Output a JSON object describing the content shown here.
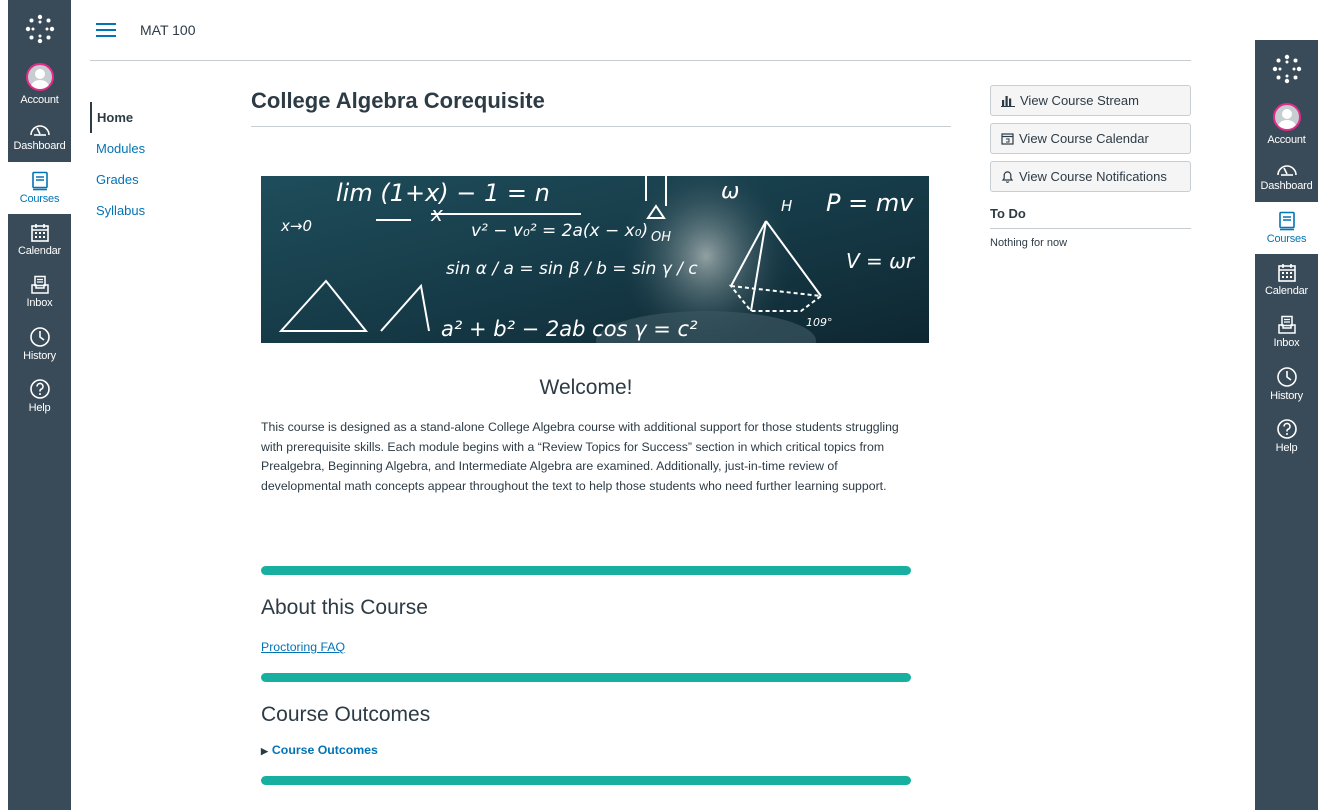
{
  "global_nav": {
    "items": [
      {
        "label": "Account",
        "icon": "account-avatar"
      },
      {
        "label": "Dashboard",
        "icon": "dashboard-icon"
      },
      {
        "label": "Courses",
        "icon": "courses-icon",
        "active": true
      },
      {
        "label": "Calendar",
        "icon": "calendar-icon"
      },
      {
        "label": "Inbox",
        "icon": "inbox-icon"
      },
      {
        "label": "History",
        "icon": "history-icon"
      },
      {
        "label": "Help",
        "icon": "help-icon"
      }
    ]
  },
  "header": {
    "breadcrumb": "MAT 100"
  },
  "course_nav": {
    "items": [
      {
        "label": "Home",
        "active": true
      },
      {
        "label": "Modules"
      },
      {
        "label": "Grades"
      },
      {
        "label": "Syllabus"
      }
    ]
  },
  "main": {
    "title": "College Algebra Corequisite",
    "welcome": "Welcome!",
    "intro": "This course is designed as a stand-alone College Algebra course with additional support for those students struggling with prerequisite skills. Each module begins with a “Review Topics for Success” section in which critical topics from Prealgebra, Beginning Algebra, and Intermediate Algebra are examined. Additionally, just-in-time review of developmental math concepts appear throughout the text to help those students who need further learning support.",
    "about_title": "About this Course",
    "proctoring_link": "Proctoring FAQ",
    "outcomes_title": "Course Outcomes",
    "outcomes_toggle": "Course Outcomes",
    "banner_formulas": {
      "limit": "lim (1+x) − 1 = n",
      "limit_sub": "x→0",
      "frac_den": "x",
      "velocity": "v² − v₀² = 2a(x − x₀)",
      "sine_rule": "sin α / a = sin β / b = sin γ / c",
      "cosine_rule": "a² + b² − 2ab cos γ = c²",
      "momentum": "P = mv",
      "angular": "V = ωr",
      "omega": "ω",
      "oh": "OH",
      "h": "H",
      "angle": "109°"
    }
  },
  "aside": {
    "buttons": [
      {
        "label": "View Course Stream",
        "icon": "bar-chart-icon"
      },
      {
        "label": "View Course Calendar",
        "icon": "calendar-icon"
      },
      {
        "label": "View Course Notifications",
        "icon": "bell-icon"
      }
    ],
    "todo_title": "To Do",
    "todo_empty": "Nothing for now"
  },
  "colors": {
    "nav_bg": "#394b58",
    "link": "#0374b5",
    "divider_bar": "#17b0a0",
    "avatar_ring": "#e42b8a",
    "text": "#2d3b45"
  }
}
